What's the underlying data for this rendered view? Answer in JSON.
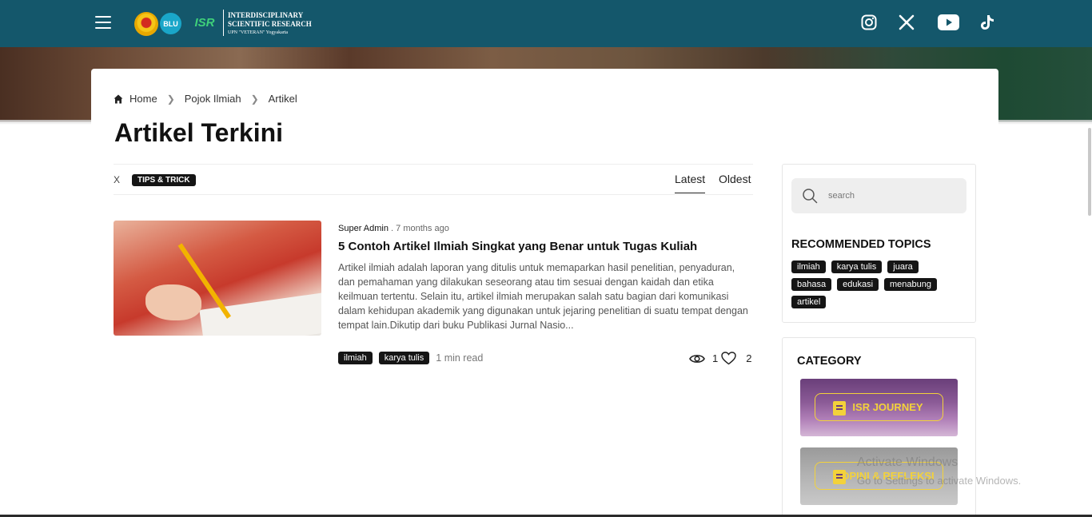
{
  "nav": {
    "menu_icon": "hamburger-icon",
    "logo_blu": "BLU",
    "logo_isr": "ISR",
    "logo_line1": "INTERDISCIPLINARY",
    "logo_line2": "SCIENTIFIC RESEARCH",
    "logo_line3": "UPN \"VETERAN\" Yogyakarta",
    "social": [
      "instagram-icon",
      "x-icon",
      "youtube-icon",
      "tiktok-icon"
    ]
  },
  "breadcrumb": {
    "items": [
      "Home",
      "Pojok Ilmiah",
      "Artikel"
    ]
  },
  "page": {
    "title": "Artikel Terkini"
  },
  "filter": {
    "clear": "X",
    "active_tag": "TIPS & TRICK",
    "sort_latest": "Latest",
    "sort_oldest": "Oldest"
  },
  "article": {
    "author": "Super Admin",
    "time": " . 7 months ago",
    "title": "5 Contoh Artikel Ilmiah Singkat yang Benar untuk Tugas Kuliah",
    "excerpt": "Artikel ilmiah adalah laporan yang ditulis untuk memaparkan hasil penelitian, penyaduran, dan pemahaman yang dilakukan seseorang atau tim sesuai dengan kaidah dan etika keilmuan tertentu. Selain itu, artikel ilmiah merupakan salah satu bagian dari komunikasi dalam kehidupan akademik yang digunakan untuk jejaring penelitian di suatu tempat dengan tempat lain.Dikutip dari buku Publikasi Jurnal Nasio...",
    "tags": [
      "ilmiah",
      "karya tulis"
    ],
    "read_time": "1 min read",
    "views": "1",
    "likes": "2"
  },
  "sidebar": {
    "search_placeholder": "search",
    "recommended_title": "RECOMMENDED TOPICS",
    "topics": [
      "ilmiah",
      "karya tulis",
      "juara",
      "bahasa",
      "edukasi",
      "menabung",
      "artikel"
    ],
    "category_title": "CATEGORY",
    "categories": [
      "ISR JOURNEY",
      "OPINI & REFLEKSI"
    ]
  },
  "overlay": {
    "watermark_line1": "Activate Windows",
    "watermark_line2": "Go to Settings to activate Windows."
  },
  "colors": {
    "navbar": "#14576b",
    "tag_bg": "#151515",
    "category_accent": "#f3d23a"
  }
}
